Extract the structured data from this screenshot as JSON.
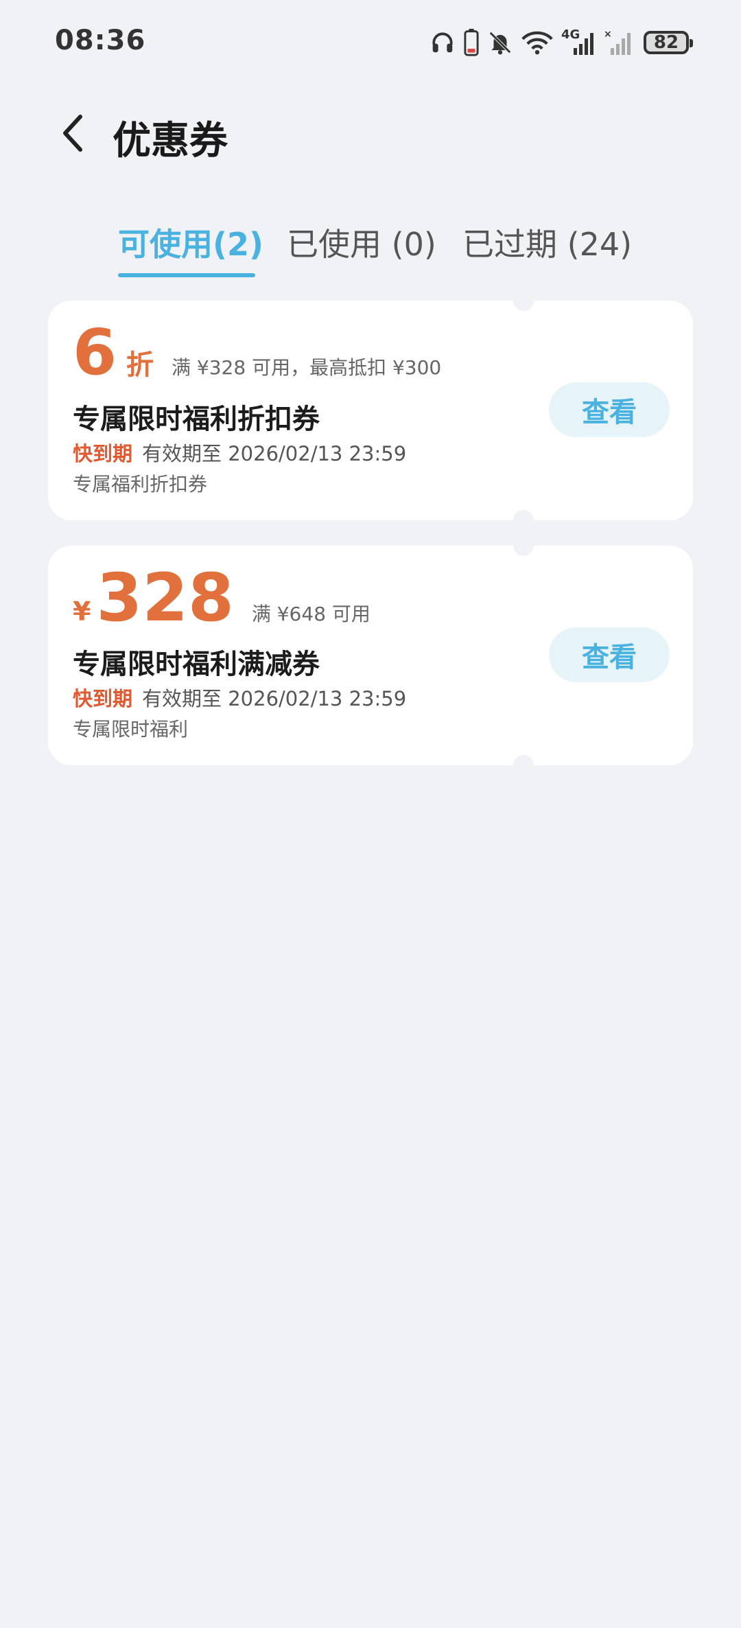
{
  "status_bar": {
    "time": "08:36",
    "network_label": "4G",
    "battery": "82",
    "icons": [
      "headphones-icon",
      "phone-battery-icon",
      "bell-muted-icon",
      "wifi-icon",
      "signal-4g-icon",
      "signal-no-sim-icon",
      "battery-icon"
    ]
  },
  "header": {
    "title": "优惠券",
    "back_icon": "chevron-left-icon"
  },
  "tabs": [
    {
      "label": "可使用(2)",
      "active": true
    },
    {
      "label": "已使用 (0)",
      "active": false
    },
    {
      "label": "已过期 (24)",
      "active": false
    }
  ],
  "coupons": [
    {
      "value": "6",
      "unit": "折",
      "condition": "满 ¥328 可用，最高抵扣 ¥300",
      "name": "专属限时福利折扣券",
      "expiry_tag": "快到期",
      "expiry": "有效期至 2026/02/13 23:59",
      "desc": "专属福利折扣券",
      "action": "查看"
    },
    {
      "currency": "¥",
      "value": "328",
      "condition": "满 ¥648 可用",
      "name": "专属限时福利满减券",
      "expiry_tag": "快到期",
      "expiry": "有效期至 2026/02/13 23:59",
      "desc": "专属限时福利",
      "action": "查看"
    }
  ],
  "colors": {
    "accent": "#4ab2e0",
    "value": "#e2703d",
    "expiry_tag": "#e2582f",
    "background": "#f0f2f5"
  }
}
